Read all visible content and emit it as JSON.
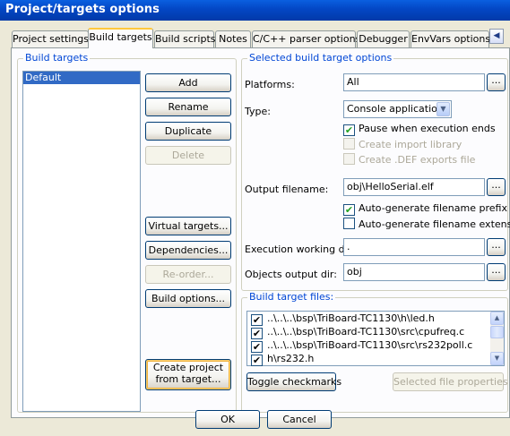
{
  "window": {
    "title": "Project/targets options"
  },
  "tabs": [
    {
      "label": "Project settings"
    },
    {
      "label": "Build targets"
    },
    {
      "label": "Build scripts"
    },
    {
      "label": "Notes"
    },
    {
      "label": "C/C++ parser options"
    },
    {
      "label": "Debugger"
    },
    {
      "label": "EnvVars options"
    }
  ],
  "tab_scroll": {
    "left": "◀",
    "right": "▶"
  },
  "build_targets": {
    "group_label": "Build targets",
    "list": [
      "Default"
    ],
    "buttons": {
      "add": "Add",
      "rename": "Rename",
      "duplicate": "Duplicate",
      "delete": "Delete",
      "virtual_targets": "Virtual targets...",
      "dependencies": "Dependencies...",
      "reorder": "Re-order...",
      "build_options": "Build options...",
      "create_line1": "Create project",
      "create_line2": "from target..."
    }
  },
  "selected_options": {
    "group_label": "Selected build target options",
    "platforms_label": "Platforms:",
    "platforms_value": "All",
    "type_label": "Type:",
    "type_value": "Console application",
    "pause_label": "Pause when execution ends",
    "create_import_label": "Create import library",
    "create_def_label": "Create .DEF exports file",
    "output_label": "Output filename:",
    "output_value": "obj\\HelloSerial.elf",
    "auto_prefix_label": "Auto-generate filename prefix",
    "auto_ext_label": "Auto-generate filename extension",
    "exec_dir_label": "Execution working dir:",
    "exec_dir_value": ".",
    "obj_dir_label": "Objects output dir:",
    "obj_dir_value": "obj",
    "dots": "..."
  },
  "checks": {
    "pause": true,
    "create_import": false,
    "create_def": false,
    "auto_prefix": true,
    "auto_ext": false
  },
  "target_files": {
    "group_label": "Build target files:",
    "files": [
      "..\\..\\..\\bsp\\TriBoard-TC1130\\h\\led.h",
      "..\\..\\..\\bsp\\TriBoard-TC1130\\src\\cpufreq.c",
      "..\\..\\..\\bsp\\TriBoard-TC1130\\src\\rs232poll.c",
      "h\\rs232.h"
    ],
    "toggle_label": "Toggle checkmarks",
    "selected_props_label": "Selected file properties"
  },
  "dialog_buttons": {
    "ok": "OK",
    "cancel": "Cancel"
  },
  "check_glyph": "✔"
}
